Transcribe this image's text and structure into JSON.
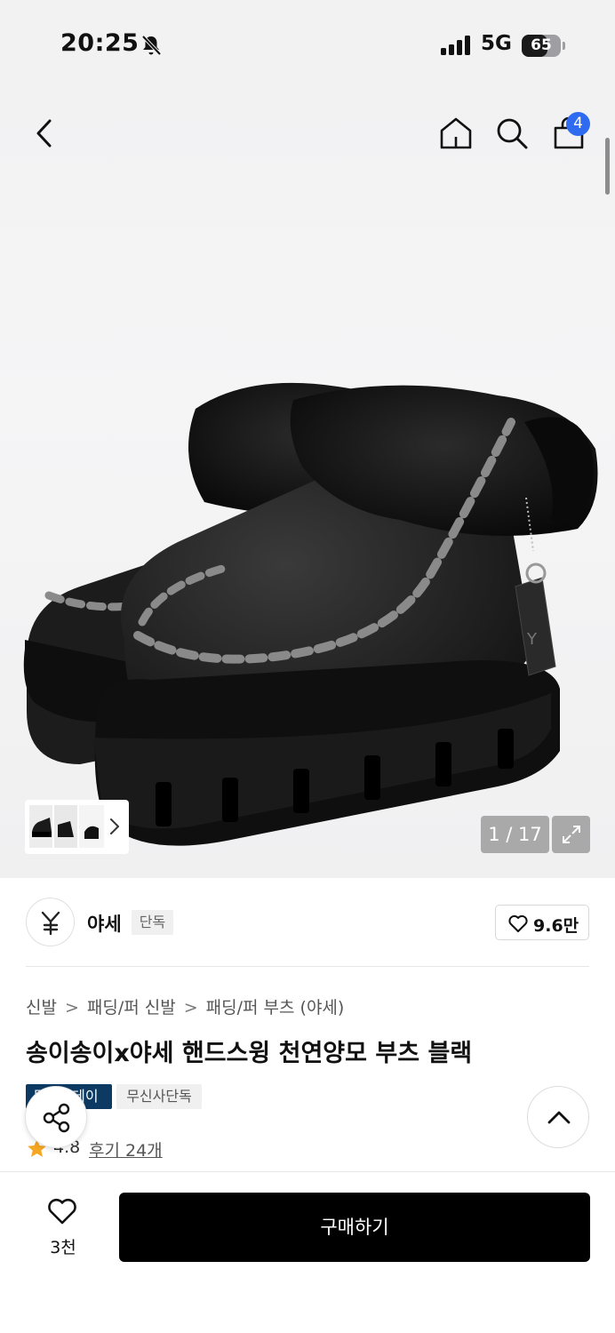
{
  "status_bar": {
    "time": "20:25",
    "network": "5G",
    "battery_level": "65",
    "battery_fraction": 0.65,
    "icons": [
      "bell-slash-icon",
      "signal-icon",
      "battery-icon"
    ]
  },
  "nav": {
    "icons": [
      "back-icon",
      "home-icon",
      "search-icon",
      "shopping-bag-icon"
    ],
    "cart_count": "4"
  },
  "gallery": {
    "counter": "1 / 17",
    "icons": [
      "chevron-right-icon",
      "expand-icon"
    ]
  },
  "brand": {
    "name": "야세",
    "exclusive_label": "단독",
    "like_count": "9.6만"
  },
  "breadcrumb": {
    "items": [
      "신발",
      "패딩/퍼 신발",
      "패딩/퍼 부츠 (야세)"
    ],
    "separator": ">"
  },
  "product": {
    "title": "송이송이x야세 핸드스윙 천연양모 부츠 블랙",
    "tags": [
      "무신사데이",
      "무신사단독"
    ],
    "rating": "4.8",
    "review_link": "후기 24개"
  },
  "bottom_bar": {
    "wishlist_count": "3천",
    "buy_label": "구매하기"
  },
  "colors": {
    "accent_blue": "#2f6bf0",
    "tag_dark": "#0d3a63",
    "buy_button": "#000000",
    "star": "#f5a623"
  }
}
